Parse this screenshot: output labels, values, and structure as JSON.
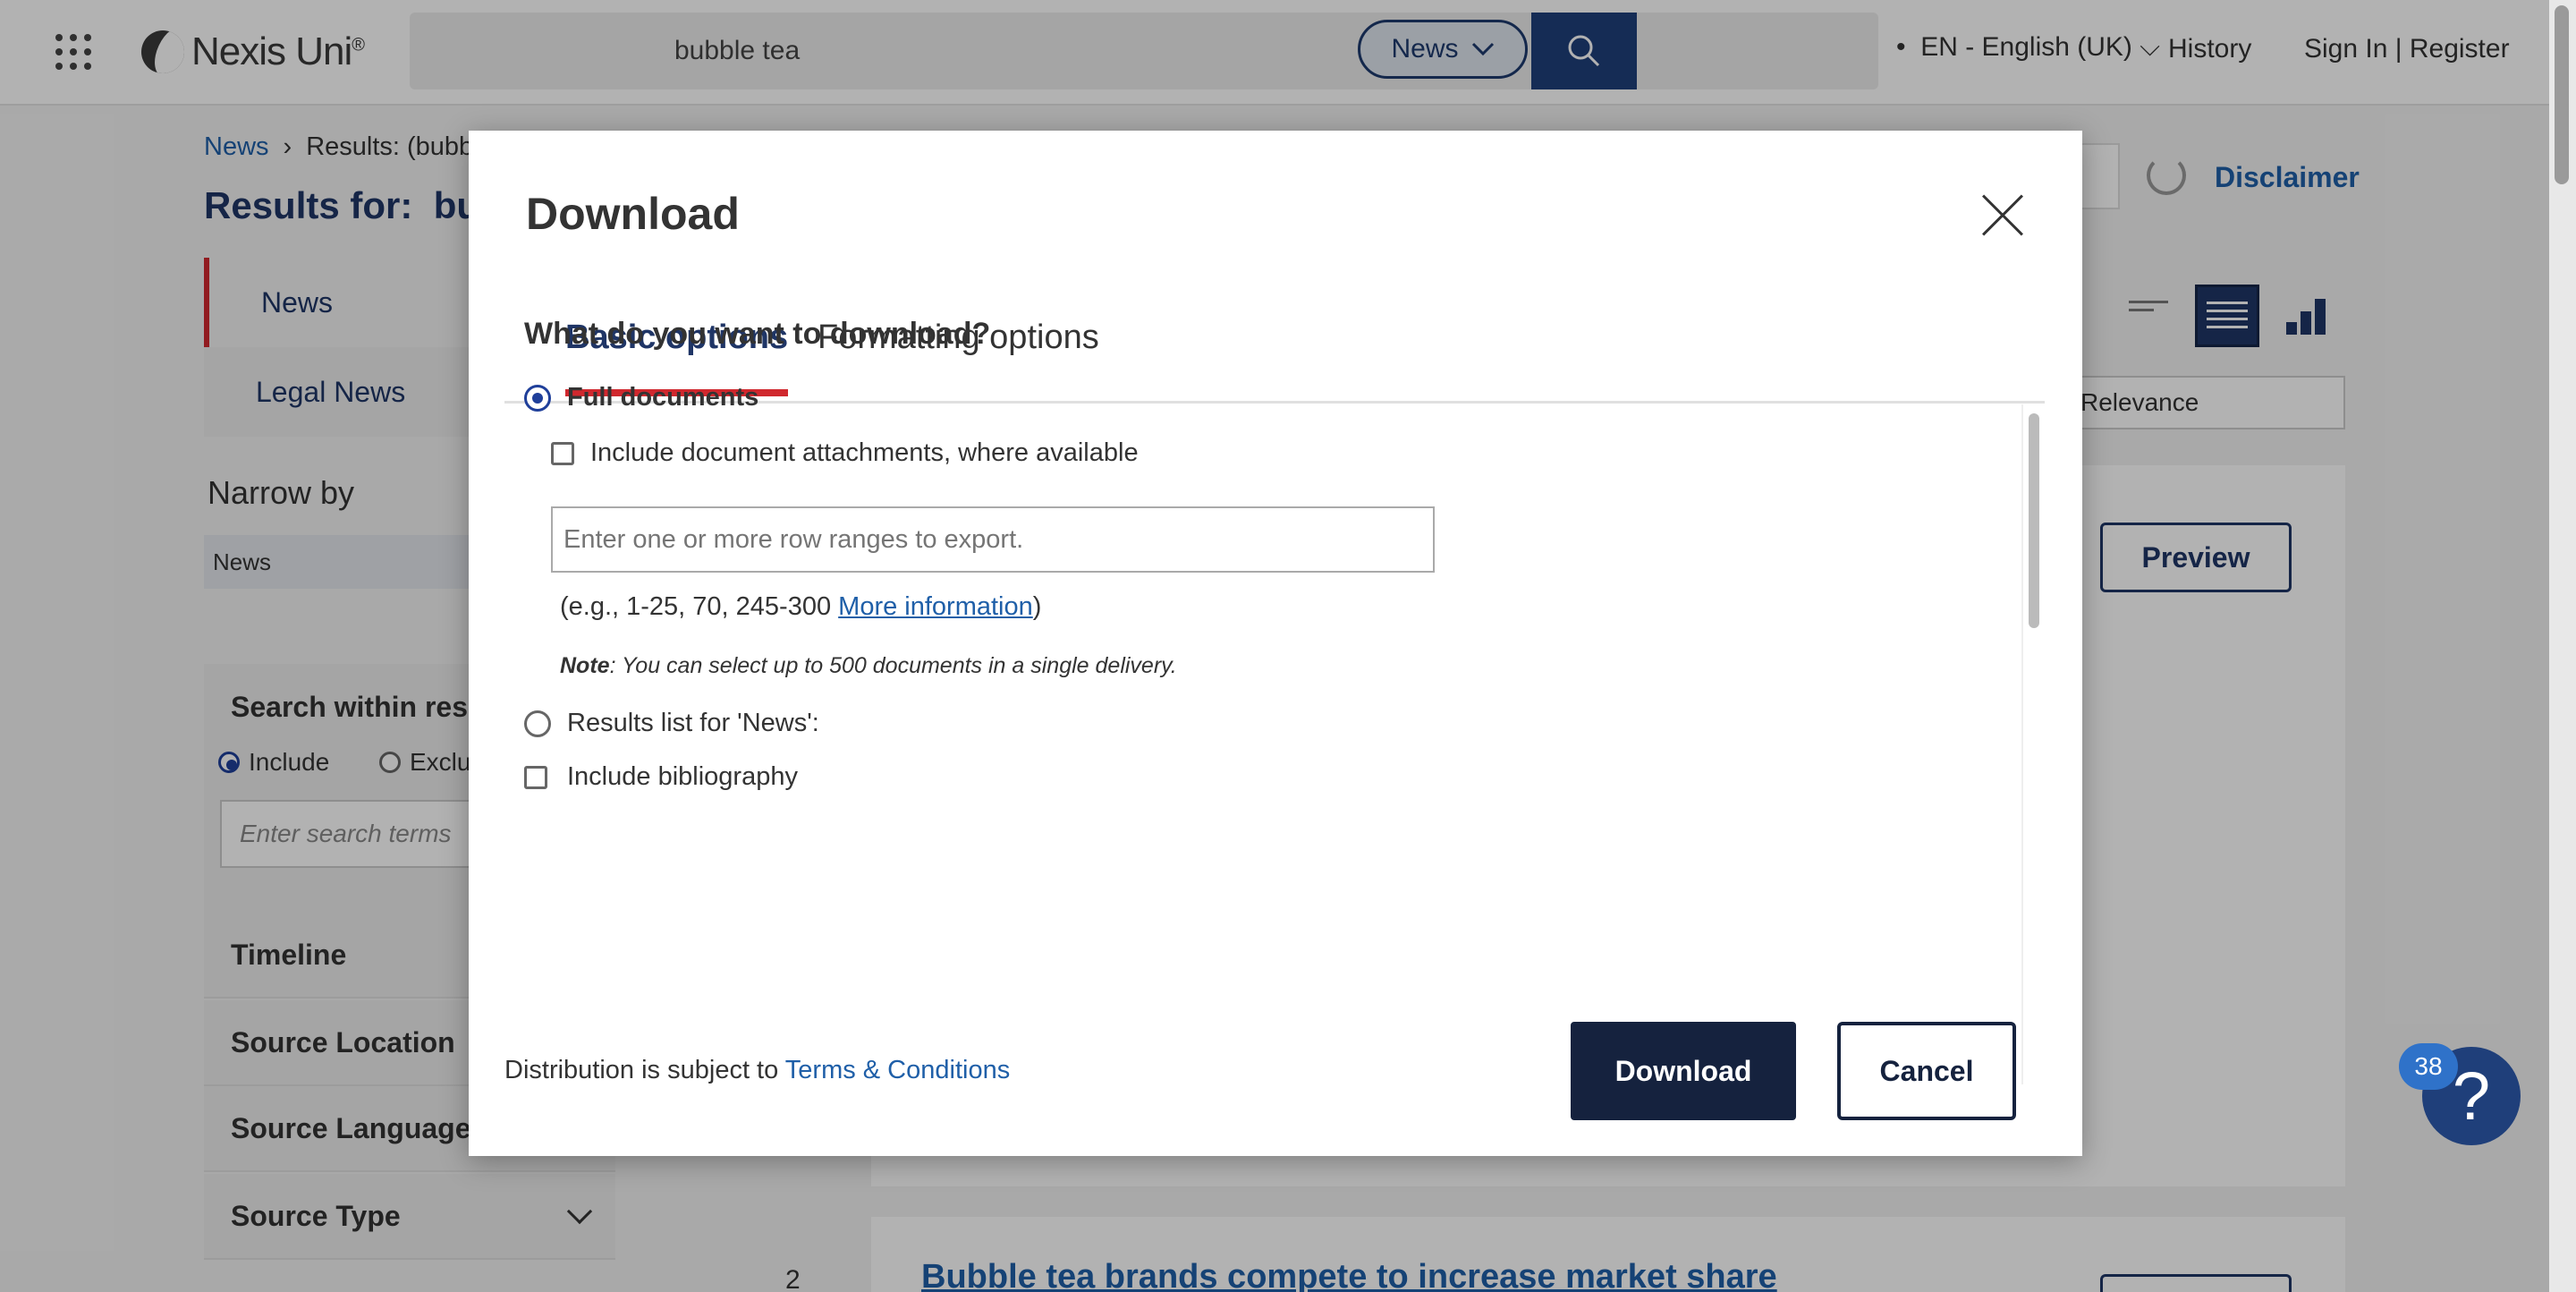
{
  "header": {
    "brand": "Nexis Uni",
    "brand_mark": "®",
    "search_value": "bubble tea",
    "scope_label": "News",
    "language": "EN - English (UK)",
    "history": "History",
    "signin": "Sign In | Register"
  },
  "breadcrumb": {
    "root": "News",
    "current": "Results: (bubble"
  },
  "results_title": {
    "prefix": "Results for:",
    "query": "bubb"
  },
  "sidebar": {
    "items": [
      {
        "label": "News"
      },
      {
        "label": "Legal News"
      }
    ],
    "narrow_by": "Narrow by",
    "narrow_chip": "News",
    "search_within_title": "Search within resu",
    "include_label": "Include",
    "exclude_label": "Exclu",
    "search_placeholder": "Enter search terms",
    "facets": [
      "Timeline",
      "Source Location",
      "Source Language",
      "Source Type"
    ]
  },
  "toolbar": {
    "disclaimer": "Disclaimer",
    "sort_value": "Relevance"
  },
  "results": {
    "preview_label": "Preview",
    "second_number": "2",
    "second_title": "Bubble tea brands compete to increase market share"
  },
  "modal": {
    "title": "Download",
    "tabs": [
      {
        "label": "Basic options",
        "active": true
      },
      {
        "label": "Formatting options",
        "active": false
      }
    ],
    "question": "What do you want to download?",
    "opt_full": "Full documents",
    "opt_attach": "Include document attachments, where available",
    "range_placeholder": "Enter one or more row ranges to export.",
    "range_example": "(e.g., 1-25, 70, 245-300 ",
    "more_info": "More information",
    "range_example_close": ")",
    "note_label": "Note",
    "note_text": ": You can select up to 500 documents in a single delivery.",
    "opt_list": "Results list for 'News':",
    "opt_biblio": "Include bibliography",
    "distribution_prefix": "Distribution is subject to ",
    "terms_link": "Terms & Conditions",
    "download_label": "Download",
    "cancel_label": "Cancel"
  },
  "help": {
    "badge": "38",
    "glyph": "?"
  },
  "colors": {
    "navy": "#15223e",
    "accent_red": "#d0282e",
    "link_blue": "#1f5fa8"
  }
}
